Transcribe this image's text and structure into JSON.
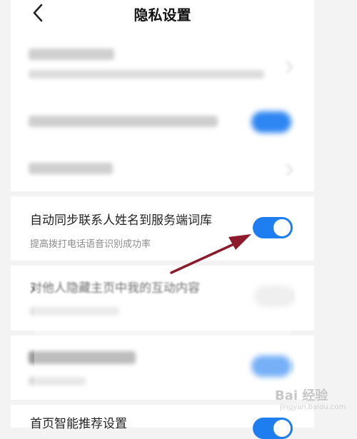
{
  "header": {
    "title": "隐私设置"
  },
  "focused_row": {
    "title": "自动同步联系人姓名到服务端词库",
    "subtitle": "提高拨打电话语音识别成功率",
    "toggle_on": true
  },
  "partial_row": {
    "title_visible": "对他人隐藏主页中我的互动内容"
  },
  "bottom_row": {
    "title": "首页智能推荐设置"
  },
  "watermark": {
    "logo_text": "Bai 经验",
    "url": "jingyan.baidu.com"
  },
  "colors": {
    "accent": "#1e7ef0",
    "background": "#f3f3f3",
    "arrow": "#8b1a2a"
  }
}
